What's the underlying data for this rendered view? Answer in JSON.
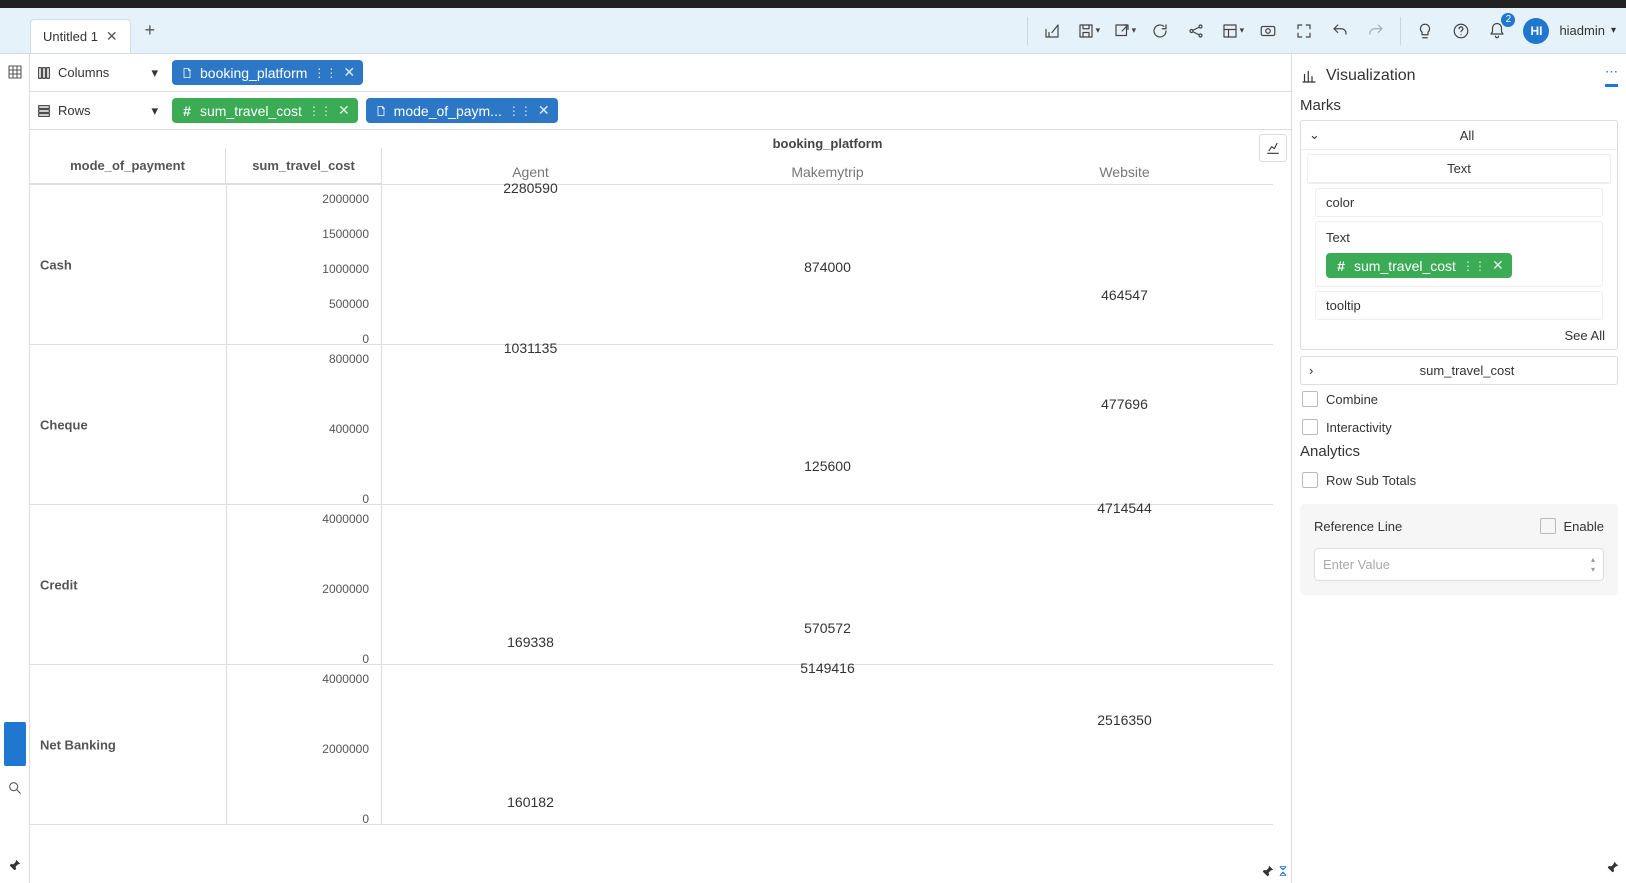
{
  "header": {
    "tab_title": "Untitled 1",
    "avatar_initials": "HI",
    "username": "hiadmin",
    "notification_count": "2"
  },
  "shelves": {
    "columns_label": "Columns",
    "rows_label": "Rows",
    "columns": [
      {
        "label": "booking_platform",
        "type": "dim"
      }
    ],
    "rows": [
      {
        "label": "sum_travel_cost",
        "type": "meas"
      },
      {
        "label": "mode_of_paym...",
        "type": "dim"
      }
    ]
  },
  "chart_data": {
    "type": "bar",
    "column_field": "booking_platform",
    "row_header_left": "mode_of_payment",
    "row_header_right": "sum_travel_cost",
    "categories": [
      "Agent",
      "Makemytrip",
      "Website"
    ],
    "rows": [
      {
        "name": "Cash",
        "ylim": [
          0,
          2000000
        ],
        "ticks": [
          2000000,
          1500000,
          1000000,
          500000,
          0
        ],
        "values": [
          2280590,
          874000,
          464547
        ]
      },
      {
        "name": "Cheque",
        "ylim": [
          0,
          800000
        ],
        "ticks": [
          800000,
          400000,
          0
        ],
        "values": [
          1031135,
          125600,
          477696
        ]
      },
      {
        "name": "Credit",
        "ylim": [
          0,
          4000000
        ],
        "ticks": [
          4000000,
          2000000,
          0
        ],
        "values": [
          169338,
          570572,
          4714544
        ]
      },
      {
        "name": "Net Banking",
        "ylim": [
          0,
          4000000
        ],
        "ticks": [
          4000000,
          2000000,
          0
        ],
        "values": [
          160182,
          5149416,
          2516350
        ]
      }
    ]
  },
  "viz": {
    "title": "Visualization",
    "marks_title": "Marks",
    "all_label": "All",
    "text_label": "Text",
    "color_label": "color",
    "text_section": "Text",
    "text_pill": "sum_travel_cost",
    "tooltip_label": "tooltip",
    "see_all": "See All",
    "measure_acc": "sum_travel_cost",
    "combine": "Combine",
    "interactivity": "Interactivity",
    "analytics_title": "Analytics",
    "row_sub_totals": "Row Sub Totals",
    "reference_line": "Reference Line",
    "enable": "Enable",
    "enter_value": "Enter Value"
  }
}
